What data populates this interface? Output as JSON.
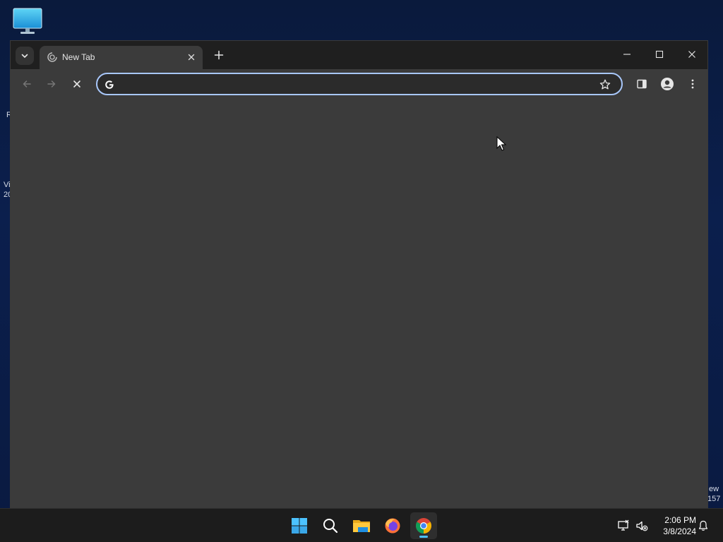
{
  "desktop": {
    "peek_texts": [
      "R",
      "Vi",
      "20",
      "ew",
      "157"
    ]
  },
  "browser": {
    "tab": {
      "title": "New Tab"
    },
    "omnibox": {
      "value": "",
      "placeholder": ""
    }
  },
  "taskbar": {
    "apps": [
      "start-icon",
      "search-icon",
      "file-explorer-icon",
      "firefox-icon",
      "chrome-icon"
    ],
    "clock": {
      "time": "2:06 PM",
      "date": "3/8/2024"
    }
  },
  "colors": {
    "accent": "#a8c7fa",
    "taskbar_indicator": "#4cc2ff",
    "content_bg": "#3b3b3b"
  }
}
